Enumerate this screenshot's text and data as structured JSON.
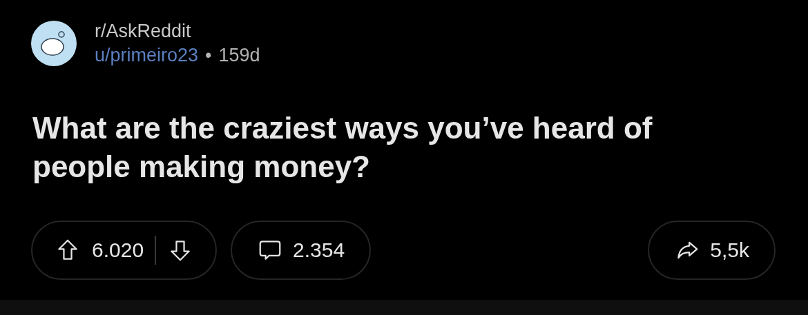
{
  "post": {
    "subreddit": "r/AskReddit",
    "author": "u/primeiro23",
    "separator": "•",
    "age": "159d",
    "title": "What are the craziest ways you’ve heard of people making money?"
  },
  "actions": {
    "score": "6.020",
    "comments": "2.354",
    "shares": "5,5k"
  }
}
